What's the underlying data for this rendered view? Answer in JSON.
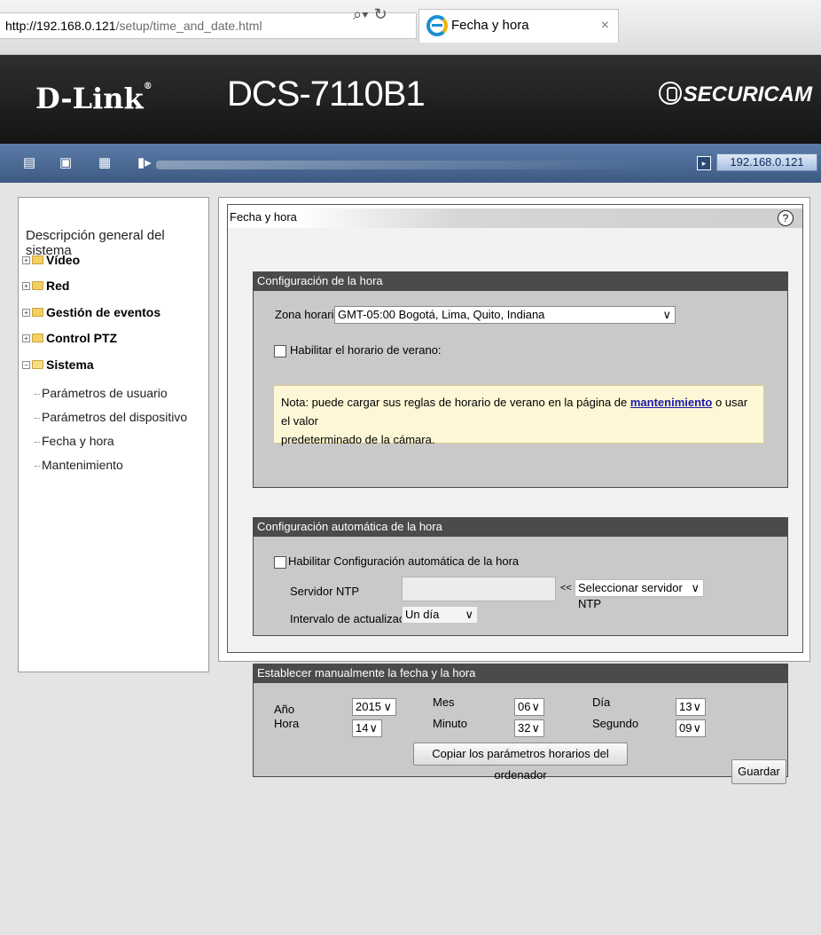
{
  "browser": {
    "url_host": "http://192.168.0.121",
    "url_path": "/setup/time_and_date.html",
    "tab_title": "Fecha y hora"
  },
  "header": {
    "brand": "D-Link",
    "model": "DCS-7110B1",
    "product_line": "SECURICAM"
  },
  "toolbar": {
    "ip": "192.168.0.121"
  },
  "sidebar": {
    "title": "Descripción general del sistema",
    "groups": [
      {
        "label": "Vídeo"
      },
      {
        "label": "Red"
      },
      {
        "label": "Gestión de eventos"
      },
      {
        "label": "Control PTZ"
      },
      {
        "label": "Sistema"
      }
    ],
    "sistema_items": [
      {
        "label": "Parámetros de usuario"
      },
      {
        "label": "Parámetros del dispositivo"
      },
      {
        "label": "Fecha y hora"
      },
      {
        "label": "Mantenimiento"
      }
    ]
  },
  "main": {
    "title": "Fecha y hora",
    "help": "?",
    "time_config": {
      "heading": "Configuración de la hora",
      "timezone_label": "Zona horaria:",
      "timezone_value": "GMT-05:00 Bogotá, Lima, Quito, Indiana",
      "dst_label": "Habilitar el horario de verano:",
      "note_before": "Nota: puede cargar sus reglas de horario de verano en la página de ",
      "note_link": "mantenimiento",
      "note_after": " o usar el valor",
      "note_line2": "predeterminado de la cámara."
    },
    "auto_config": {
      "heading": "Configuración automática de la hora",
      "enable_label": "Habilitar Configuración automática de la hora",
      "ntp_label": "Servidor NTP",
      "ntp_value": "",
      "arrows": "<<",
      "ntp_select": "Seleccionar servidor NTP",
      "interval_label": "Intervalo de actualización",
      "interval_value": "Un día"
    },
    "manual_config": {
      "heading": "Establecer manualmente la fecha y la hora",
      "year_label": "Año",
      "year_value": "2015",
      "month_label": "Mes",
      "month_value": "06",
      "day_label": "Día",
      "day_value": "13",
      "hour_label": "Hora",
      "hour_value": "14",
      "minute_label": "Minuto",
      "minute_value": "32",
      "second_label": "Segundo",
      "second_value": "09",
      "copy_button": "Copiar los parámetros horarios del ordenador"
    },
    "save_button": "Guardar"
  },
  "icons": {
    "dropdown": "chevron-down-icon",
    "help": "help-icon",
    "tab_close": "×"
  }
}
